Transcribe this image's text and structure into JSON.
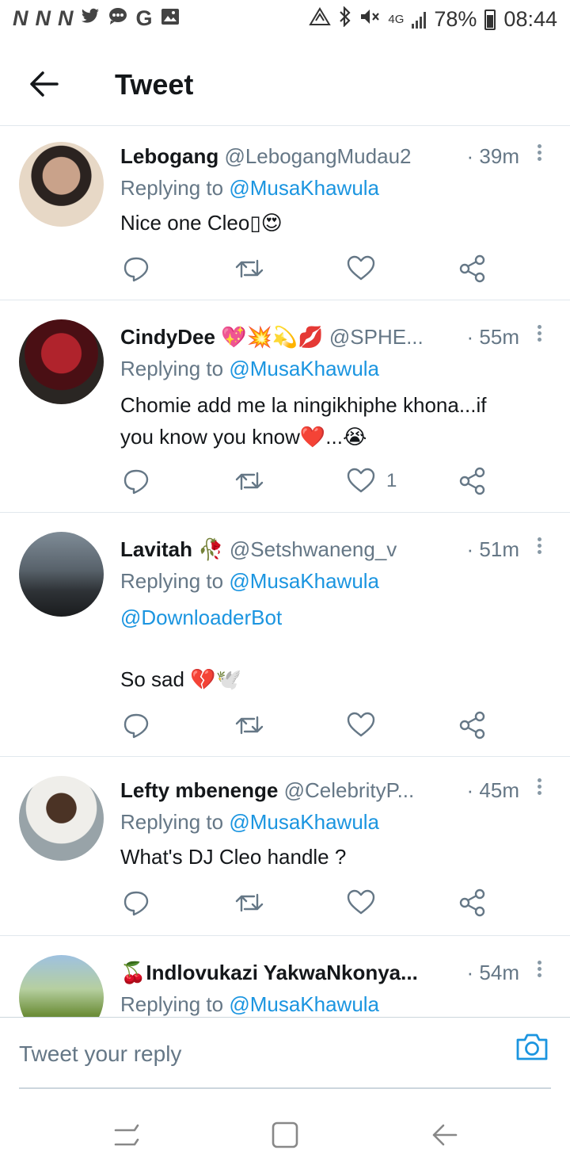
{
  "status_bar": {
    "left_icons": [
      "network-n-icon",
      "network-n-icon",
      "network-n-icon",
      "twitter-bird-icon",
      "chat-icon",
      "google-icon",
      "gallery-icon"
    ],
    "network_letters": [
      "N",
      "N",
      "N"
    ],
    "google_letter": "G",
    "right_icons": [
      "data-saver-icon",
      "bluetooth-icon",
      "mute-icon",
      "signal-4g-icon",
      "signal-bars-icon",
      "battery-icon"
    ],
    "network_type": "4G",
    "battery": "78%",
    "time": "08:44"
  },
  "header": {
    "title": "Tweet",
    "back_icon": "arrow-left-icon"
  },
  "tweets": [
    {
      "name": "Lebogang",
      "name_emoji": "",
      "handle": "@LebogangMudau2",
      "time": "· 39m",
      "replying_prefix": "Replying to",
      "replying_to": "@MusaKhawula",
      "text": "Nice one Cleo▯😍",
      "likes": ""
    },
    {
      "name": "CindyDee",
      "name_emoji": "💖💥💫💋",
      "handle": "@SPHE...",
      "time": "· 55m",
      "replying_prefix": "Replying to",
      "replying_to": "@MusaKhawula",
      "text_line1": "Chomie add me la ningikhiphe khona...if",
      "text_line2": "you know you know❤️...😭",
      "likes": "1"
    },
    {
      "name": "Lavitah",
      "name_emoji": "🥀",
      "handle": "@Setshwaneng_v",
      "time": "· 51m",
      "replying_prefix": "Replying to",
      "replying_to": "@MusaKhawula",
      "mention_line": "@DownloaderBot",
      "text": "So sad 💔🕊️",
      "likes": ""
    },
    {
      "name": "Lefty mbenenge",
      "name_emoji": "",
      "handle": "@CelebrityP...",
      "time": "· 45m",
      "replying_prefix": "Replying to",
      "replying_to": "@MusaKhawula",
      "text": "What's DJ Cleo handle ?",
      "likes": ""
    },
    {
      "name": "🍒Indlovukazi YakwaNkonya...",
      "name_emoji": "",
      "handle": "",
      "time": "· 54m",
      "replying_prefix": "Replying to",
      "replying_to": "@MusaKhawula"
    }
  ],
  "reply_bar": {
    "placeholder": "Tweet your reply",
    "camera_icon": "camera-icon"
  },
  "nav_bar": {
    "icons": [
      "recent-apps-icon",
      "home-icon",
      "back-icon"
    ]
  },
  "colors": {
    "link": "#1b95e0",
    "secondary_text": "#657786",
    "divider": "#e1e8ed",
    "icon_gray": "#657786"
  }
}
